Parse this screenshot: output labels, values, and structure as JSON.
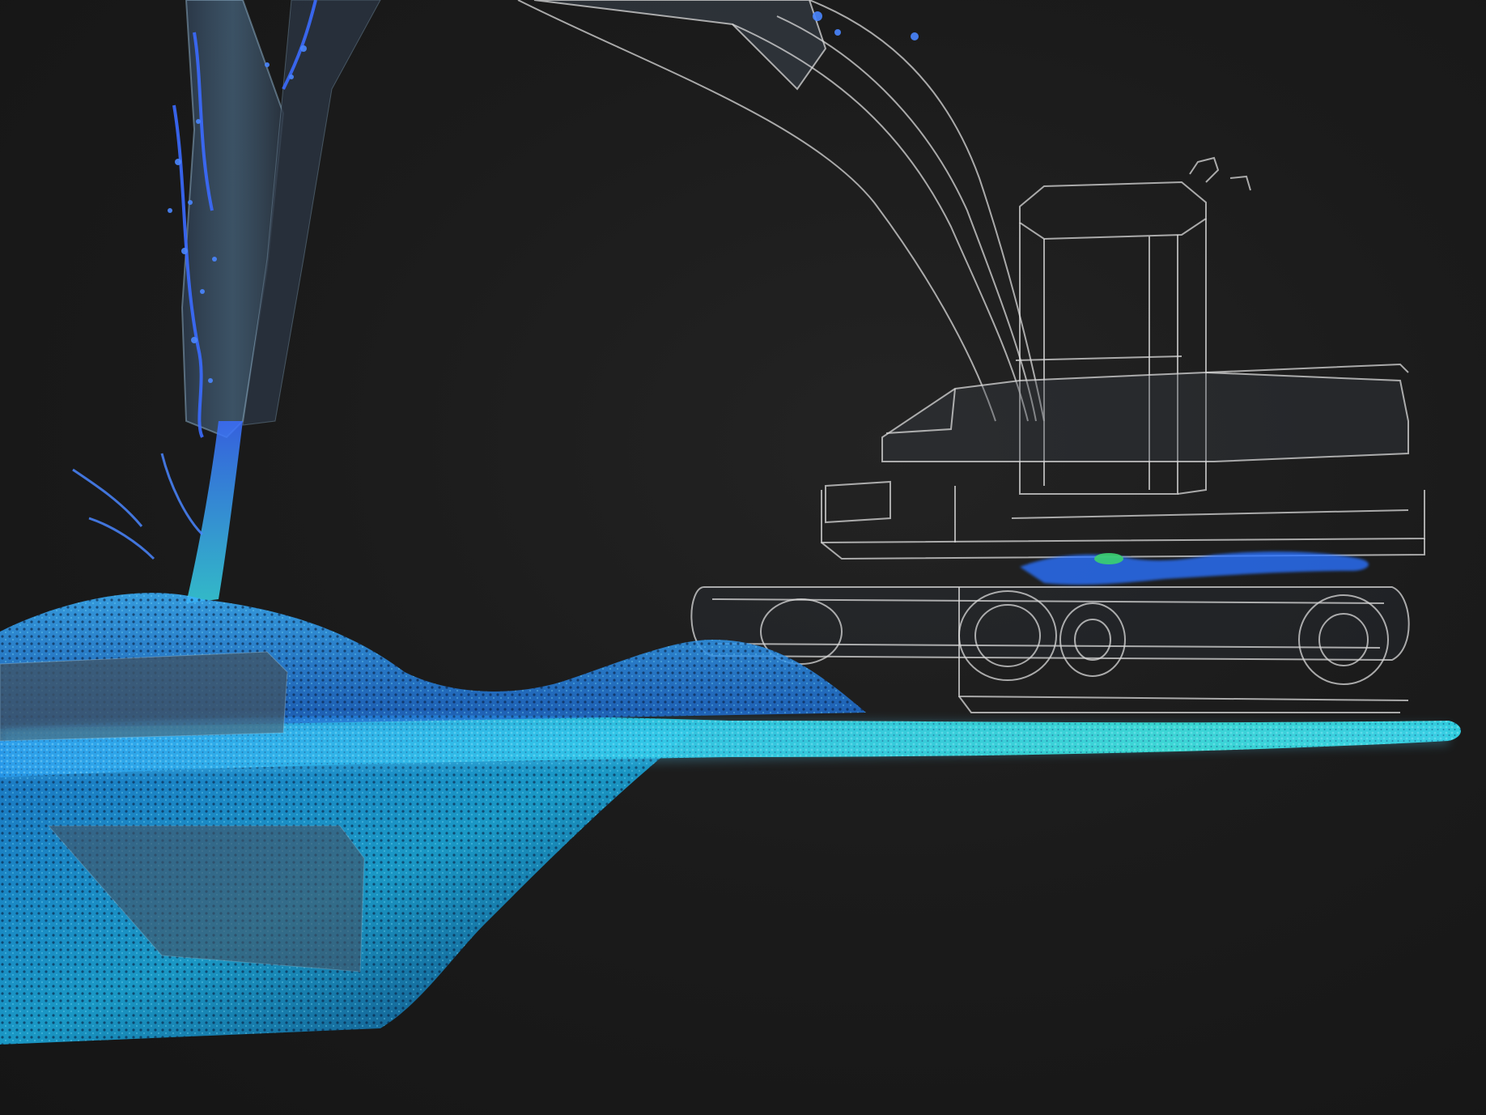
{
  "scene": {
    "background_color": "#1b1b1b",
    "excavator_line_color": "#d9d9d9",
    "point_cloud_colors": [
      "#2a6cff",
      "#1f9dff",
      "#22c7e6",
      "#2ee0c8",
      "#5ad1ff"
    ],
    "particle_stream_color": "#3aa6ff",
    "highlight_color": "#3bd16f"
  }
}
